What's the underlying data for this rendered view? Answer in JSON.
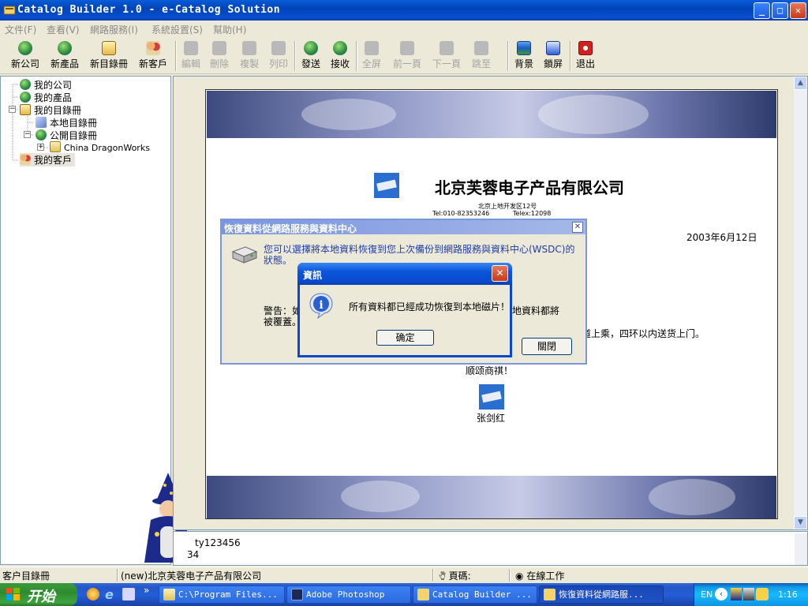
{
  "window": {
    "title": "Catalog Builder 1.0 - e-Catalog Solution",
    "minimize": "_",
    "maximize": "□",
    "close": "✕"
  },
  "menu": [
    "文件(F)",
    "查看(V)",
    "網路服務(I)",
    "系統設置(S)",
    "幫助(H)"
  ],
  "toolbar": [
    {
      "label": "新公司",
      "icon": "globe-icon",
      "enabled": true
    },
    {
      "label": "新產品",
      "icon": "globe-icon",
      "enabled": true
    },
    {
      "label": "新目錄冊",
      "icon": "catalog-icon",
      "enabled": true
    },
    {
      "label": "新客戶",
      "icon": "people-icon",
      "enabled": true
    },
    {
      "label": "編輯",
      "icon": "edit-icon",
      "enabled": false
    },
    {
      "label": "刪除",
      "icon": "delete-icon",
      "enabled": false
    },
    {
      "label": "複製",
      "icon": "copy-icon",
      "enabled": false
    },
    {
      "label": "列印",
      "icon": "print-icon",
      "enabled": false
    },
    {
      "label": "發送",
      "icon": "send-icon",
      "enabled": true
    },
    {
      "label": "接收",
      "icon": "receive-icon",
      "enabled": true
    },
    {
      "label": "全屏",
      "icon": "fullscreen-icon",
      "enabled": false
    },
    {
      "label": "前一頁",
      "icon": "prev-page-icon",
      "enabled": false
    },
    {
      "label": "下一頁",
      "icon": "next-page-icon",
      "enabled": false
    },
    {
      "label": "跳至",
      "icon": "goto-icon",
      "enabled": false
    },
    {
      "label": "背景",
      "icon": "background-icon",
      "enabled": true
    },
    {
      "label": "鎖屏",
      "icon": "lock-screen-icon",
      "enabled": true
    },
    {
      "label": "退出",
      "icon": "exit-icon",
      "enabled": true
    }
  ],
  "tree": [
    {
      "label": "我的公司",
      "icon": "globe-icon"
    },
    {
      "label": "我的產品",
      "icon": "globe-icon"
    },
    {
      "label": "我的目錄冊",
      "icon": "catalog-icon"
    },
    {
      "label": "本地目錄冊",
      "icon": "local-catalog-icon"
    },
    {
      "label": "公開目錄冊",
      "icon": "public-catalog-icon"
    },
    {
      "label": "China DragonWorks",
      "icon": "folder-icon"
    },
    {
      "label": "我的客戶",
      "icon": "people-icon"
    }
  ],
  "expanders": {
    "minus": "−",
    "plus": "+"
  },
  "catalog_page": {
    "company": "北京芙蓉电子产品有限公司",
    "address": "北京上地开发区12号",
    "tel": "Tel:010-82353246",
    "telex": "Telex:12098",
    "date": "2003年6月12日",
    "body_fragment": "道上乘，四环以内送货上门。",
    "closing": "顺颂商祺！",
    "signature": "张剑红"
  },
  "info_panel": {
    "line1": "ty123456",
    "line2": "34"
  },
  "status": {
    "left": "客户目錄冊",
    "company": "(new)北京芙蓉电子产品有限公司",
    "page": "頁碼:",
    "mode": "在線工作"
  },
  "restore_dialog": {
    "title": "恢復資料從網路服務與資料中心",
    "message": "您可以選擇將本地資料恢復到您上次備份到網路服務與資料中心(WSDC)的狀態。",
    "warning_start": "警告：如",
    "warning_mid": "地資料都將",
    "warning_end": "被覆蓋。",
    "close_label": "關閉"
  },
  "info_dialog": {
    "title": "資訊",
    "message": "所有資料都已經成功恢復到本地磁片！",
    "ok": "确定"
  },
  "taskbar": {
    "start": "开始",
    "overflow": "»",
    "tasks": [
      {
        "label": "C:\\Program Files...",
        "icon": "folder-icon",
        "active": false
      },
      {
        "label": "Adobe Photoshop",
        "icon": "photoshop-icon",
        "active": false
      },
      {
        "label": "Catalog Builder ...",
        "icon": "catalog-builder-icon",
        "active": false
      },
      {
        "label": "恢復資料從網路服...",
        "icon": "catalog-builder-icon",
        "active": true
      }
    ],
    "lang": "EN",
    "clock": "1:16"
  }
}
